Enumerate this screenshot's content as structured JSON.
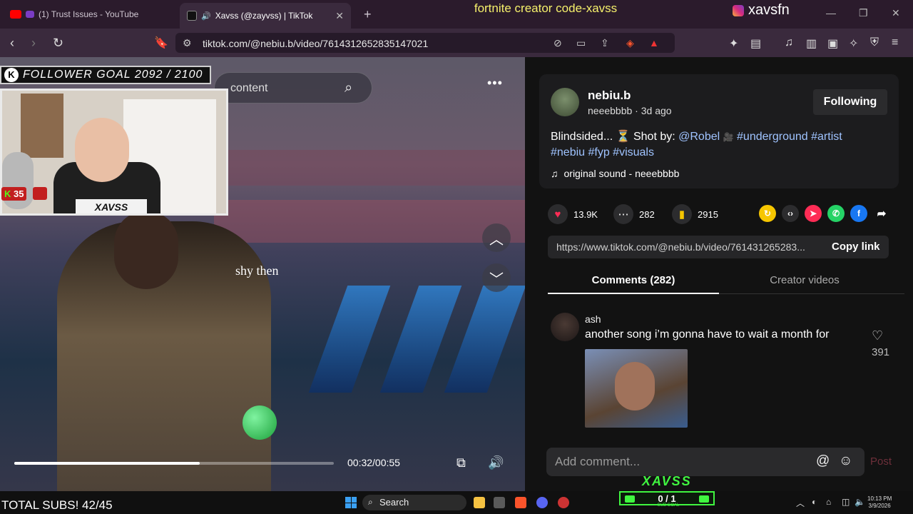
{
  "browser": {
    "tabs": [
      {
        "title": "(1) Trust Issues - YouTube",
        "active": false
      },
      {
        "title": "Xavss (@zayvss) | TikTok",
        "active": true
      }
    ],
    "new_tab": "+",
    "url": "tiktok.com/@nebiu.b/video/7614312652835147021"
  },
  "stream": {
    "title": "fortnite creator code-xavss",
    "handle": "xavsfn",
    "follower_goal": "FOLLOWER GOAL 2092 / 2100",
    "kick_count": "35",
    "cam_tag": "XAVSS",
    "total_subs": "TOTAL SUBS! 42/45",
    "subgoal_title": "XAVSS",
    "subgoal_value": "0 / 1",
    "subgoal_label": "SUB GOAL"
  },
  "video": {
    "search_placeholder": "content",
    "lyric": "shy then",
    "time": "00:32/00:55",
    "progress": 0.58
  },
  "post": {
    "author": "nebiu.b",
    "meta": "neeebbbb · 3d ago",
    "follow_label": "Following",
    "caption_text": "Blindsided... ⏳ Shot by: ",
    "caption_mention": "@Robel",
    "caption_tags": "#underground #artist",
    "caption_tags2": "#nebiu #fyp #visuals",
    "sound": "original sound - neeebbbb",
    "likes": "13.9K",
    "comments": "282",
    "saves": "2915",
    "link": "https://www.tiktok.com/@nebiu.b/video/761431265283...",
    "copy_label": "Copy link"
  },
  "tabs": {
    "comments": "Comments (282)",
    "creator": "Creator videos"
  },
  "comment": {
    "user": "ash",
    "text": "another song i’m gonna have to wait a month for",
    "likes": "391"
  },
  "composer": {
    "placeholder": "Add comment...",
    "post_label": "Post"
  },
  "taskbar": {
    "search": "Search",
    "time": "10:13 PM",
    "date": "3/9/2026"
  }
}
